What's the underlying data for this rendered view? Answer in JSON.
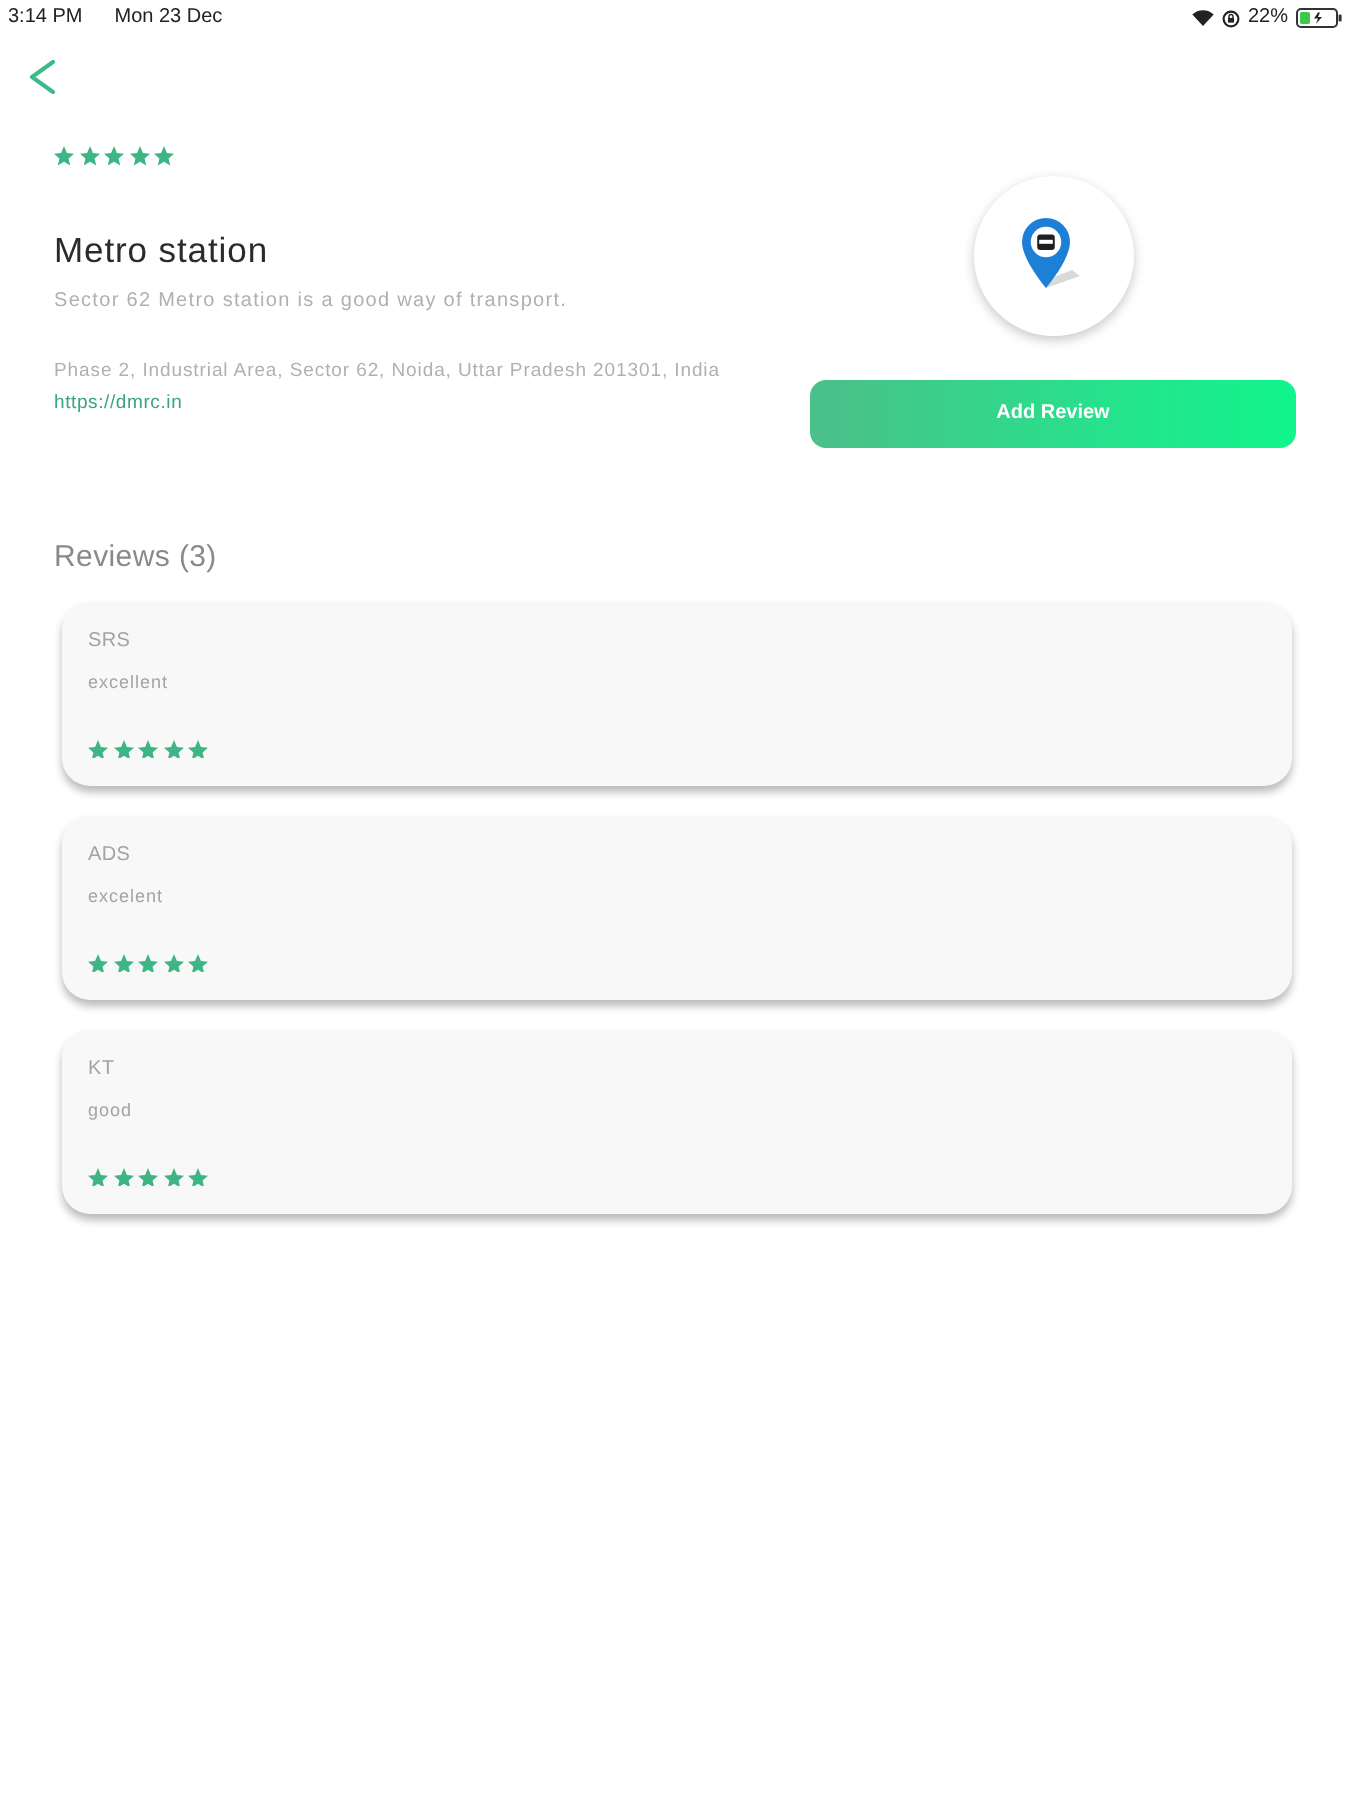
{
  "status_bar": {
    "time": "3:14 PM",
    "date": "Mon 23 Dec",
    "battery": "22%"
  },
  "place": {
    "stars": 5,
    "name": "Metro station",
    "description": "Sector 62 Metro station is a good way of transport.",
    "address": "Phase 2, Industrial Area, Sector 62, Noida, Uttar Pradesh 201301, India",
    "website": "https://dmrc.in"
  },
  "add_review_button": "Add Review",
  "reviews_heading": "Reviews (3)",
  "reviews": [
    {
      "author": "SRS",
      "comment": "excellent",
      "stars": 5
    },
    {
      "author": "ADS",
      "comment": "excelent",
      "stars": 5
    },
    {
      "author": "KT",
      "comment": "good",
      "stars": 5
    }
  ]
}
